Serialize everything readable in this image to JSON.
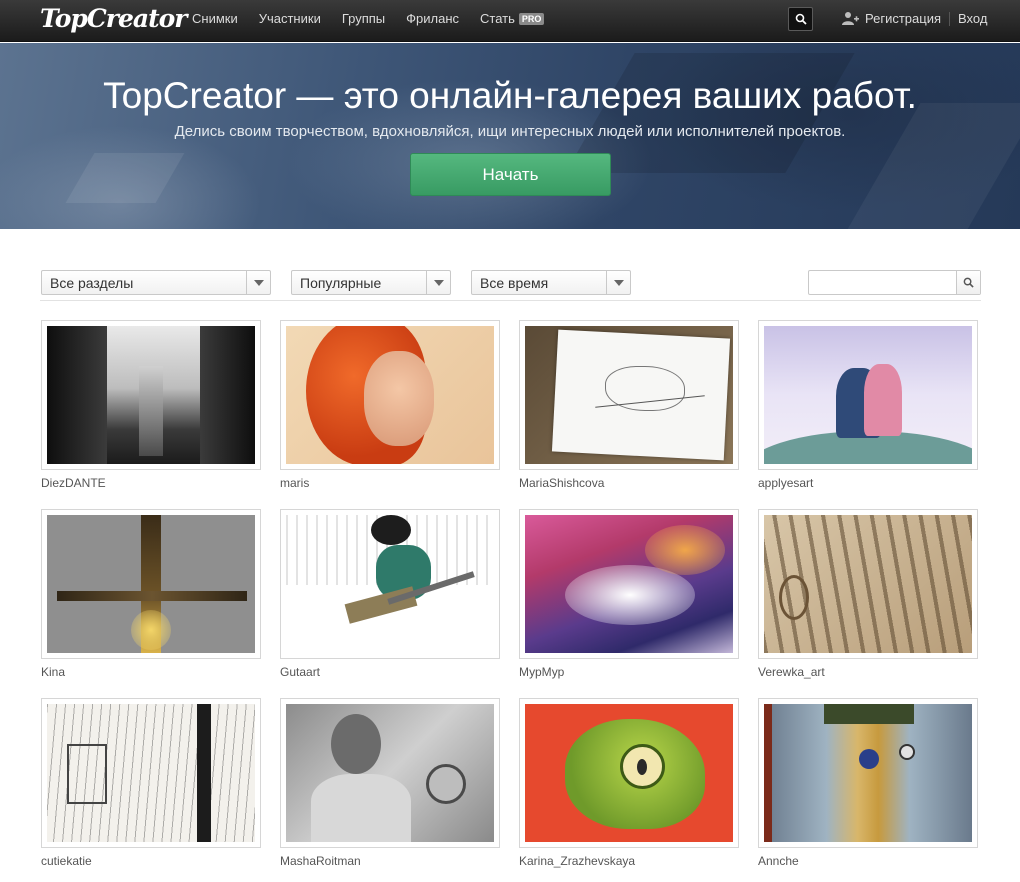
{
  "header": {
    "logo": "TopCreator",
    "nav": [
      {
        "label": "Снимки"
      },
      {
        "label": "Участники"
      },
      {
        "label": "Группы"
      },
      {
        "label": "Фриланс"
      },
      {
        "label": "Стать",
        "badge": "PRO"
      }
    ],
    "register_label": "Регистрация",
    "login_label": "Вход"
  },
  "hero": {
    "title": "TopCreator — это онлайн-галерея ваших работ.",
    "subtitle": "Делись своим творчеством, вдохновляйся, ищи интересных людей или исполнителей проектов.",
    "cta_label": "Начать"
  },
  "filters": {
    "section": "Все разделы",
    "sort": "Популярные",
    "period": "Все время",
    "search_value": ""
  },
  "gallery": [
    {
      "author": "DiezDANTE"
    },
    {
      "author": "maris"
    },
    {
      "author": "MariaShishcova"
    },
    {
      "author": "applyesart"
    },
    {
      "author": "Kina"
    },
    {
      "author": "Gutaart"
    },
    {
      "author": "МурМур"
    },
    {
      "author": "Verewka_art"
    },
    {
      "author": "cutiekatie"
    },
    {
      "author": "MashaRoitman"
    },
    {
      "author": "Karina_Zrazhevskaya"
    },
    {
      "author": "Annche"
    }
  ],
  "colors": {
    "topbar": "#232323",
    "hero": "#3e5677",
    "cta": "#45a870"
  }
}
